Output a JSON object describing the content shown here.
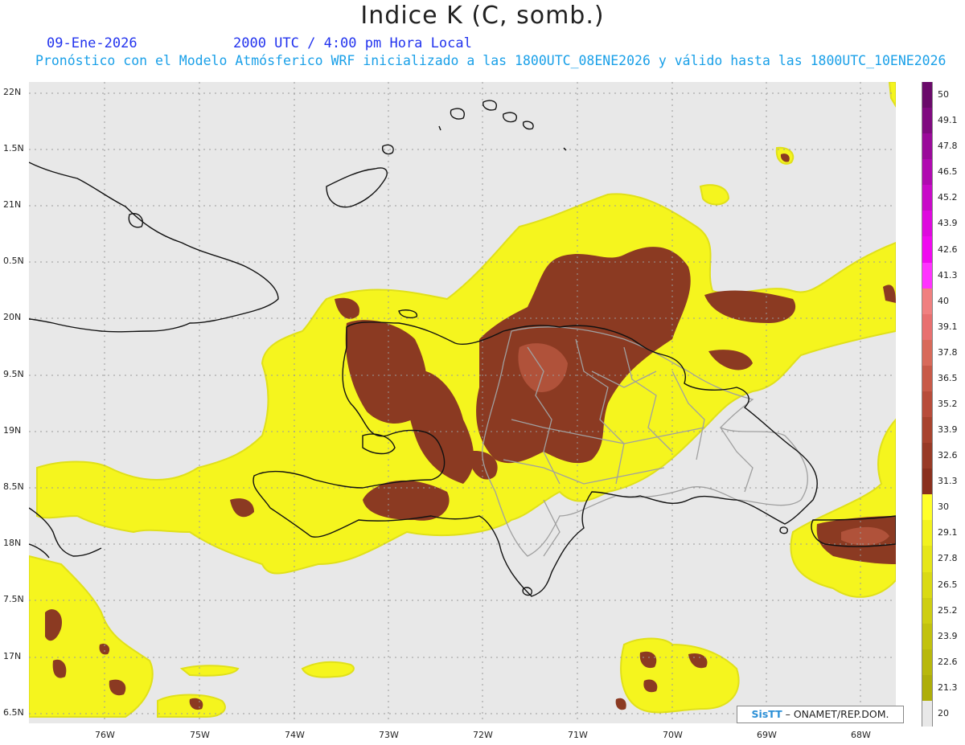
{
  "header": {
    "title": "Indice K (C, somb.)",
    "date": "09-Ene-2026",
    "time": "2000 UTC / 4:00 pm Hora Local",
    "subtitle": "Pronóstico con el Modelo Atmósferico WRF inicializado a las 1800UTC_08ENE2026 y válido hasta las  1800UTC_10ENE2026"
  },
  "map": {
    "lat_labels": [
      "22N",
      "1.5N",
      "21N",
      "0.5N",
      "20N",
      "9.5N",
      "19N",
      "8.5N",
      "18N",
      "7.5N",
      "17N",
      "6.5N"
    ],
    "lon_labels": [
      "76W",
      "75W",
      "74W",
      "73W",
      "72W",
      "71W",
      "70W",
      "69W",
      "68W"
    ],
    "grid": true,
    "colors": {
      "background": "#e8e8e8",
      "yellow_low": "#ffff33",
      "yellow_mid": "#e6e61a",
      "brown": "#8b3a22",
      "coast": "#111111",
      "province": "#999999"
    }
  },
  "colorbar": {
    "levels": [
      "50",
      "49.1",
      "47.8",
      "46.5",
      "45.2",
      "43.9",
      "42.6",
      "41.3",
      "40",
      "39.1",
      "37.8",
      "36.5",
      "35.2",
      "33.9",
      "32.6",
      "31.3",
      "30",
      "29.1",
      "27.8",
      "26.5",
      "25.2",
      "23.9",
      "22.6",
      "21.3",
      "20"
    ],
    "colors": [
      "#6a0a6a",
      "#800a80",
      "#9a0a9a",
      "#b00ab0",
      "#c80ac8",
      "#de0ade",
      "#f00af0",
      "#ff33ff",
      "#f08080",
      "#e87070",
      "#d86a5a",
      "#c85a48",
      "#b84c3a",
      "#a8432e",
      "#983a26",
      "#8a301e",
      "#ffff2a",
      "#f2f21e",
      "#e6e618",
      "#dada14",
      "#cece12",
      "#c2c20e",
      "#b8b80c",
      "#aeae0a",
      "#e8e8e8"
    ]
  },
  "credit": {
    "logo": "SisTT",
    "text": "– ONAMET/REP.DOM."
  }
}
